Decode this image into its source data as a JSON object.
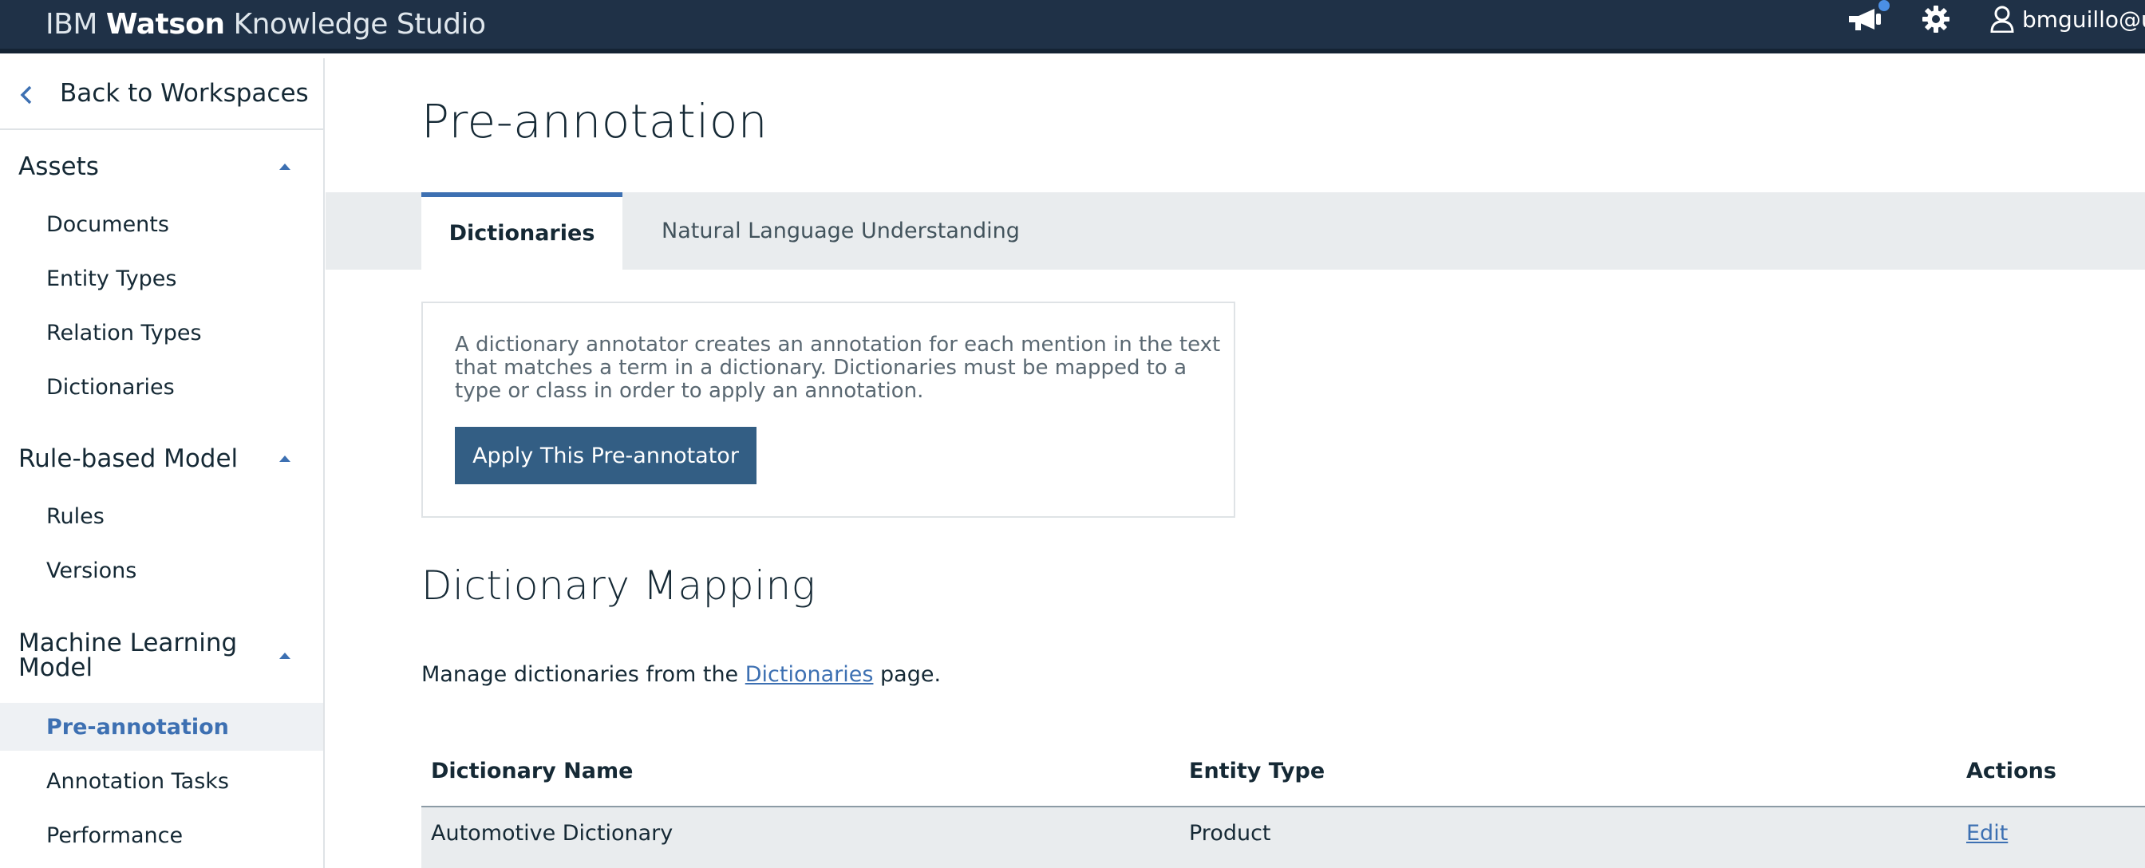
{
  "header": {
    "brand_ibm": "IBM",
    "brand_watson": "Watson",
    "brand_rest": "Knowledge Studio",
    "user": "bmguillo@us",
    "icons": [
      "announcement-icon",
      "gear-icon",
      "user-icon"
    ],
    "notification_dot_color": "#4b8fe5"
  },
  "sidebar": {
    "back_label": "Back to Workspaces",
    "sections": [
      {
        "title": "Assets",
        "items": [
          "Documents",
          "Entity Types",
          "Relation Types",
          "Dictionaries"
        ]
      },
      {
        "title": "Rule-based Model",
        "items": [
          "Rules",
          "Versions"
        ]
      },
      {
        "title": "Machine Learning Model",
        "title_line1": "Machine Learning",
        "title_line2": "Model",
        "items": [
          "Pre-annotation",
          "Annotation Tasks",
          "Performance"
        ]
      }
    ],
    "active_item": "Pre-annotation"
  },
  "main": {
    "title": "Pre-annotation",
    "tabs": [
      {
        "label": "Dictionaries",
        "selected": true
      },
      {
        "label": "Natural Language Understanding",
        "selected": false
      }
    ],
    "info": {
      "text": "A dictionary annotator creates an annotation for each mention in the text that matches a term in a dictionary. Dictionaries must be mapped to a type or class in order to apply an annotation.",
      "button": "Apply This Pre-annotator"
    },
    "mapping": {
      "title": "Dictionary Mapping",
      "manage_prefix": "Manage dictionaries from the ",
      "manage_link": "Dictionaries",
      "manage_suffix": " page."
    },
    "table": {
      "columns": [
        "Dictionary Name",
        "Entity Type",
        "Actions"
      ],
      "rows": [
        {
          "name": "Automotive Dictionary",
          "type": "Product",
          "action": "Edit"
        }
      ]
    }
  },
  "colors": {
    "header_bg": "#1f3147",
    "accent": "#3d70b2",
    "button_bg": "#335e84"
  }
}
